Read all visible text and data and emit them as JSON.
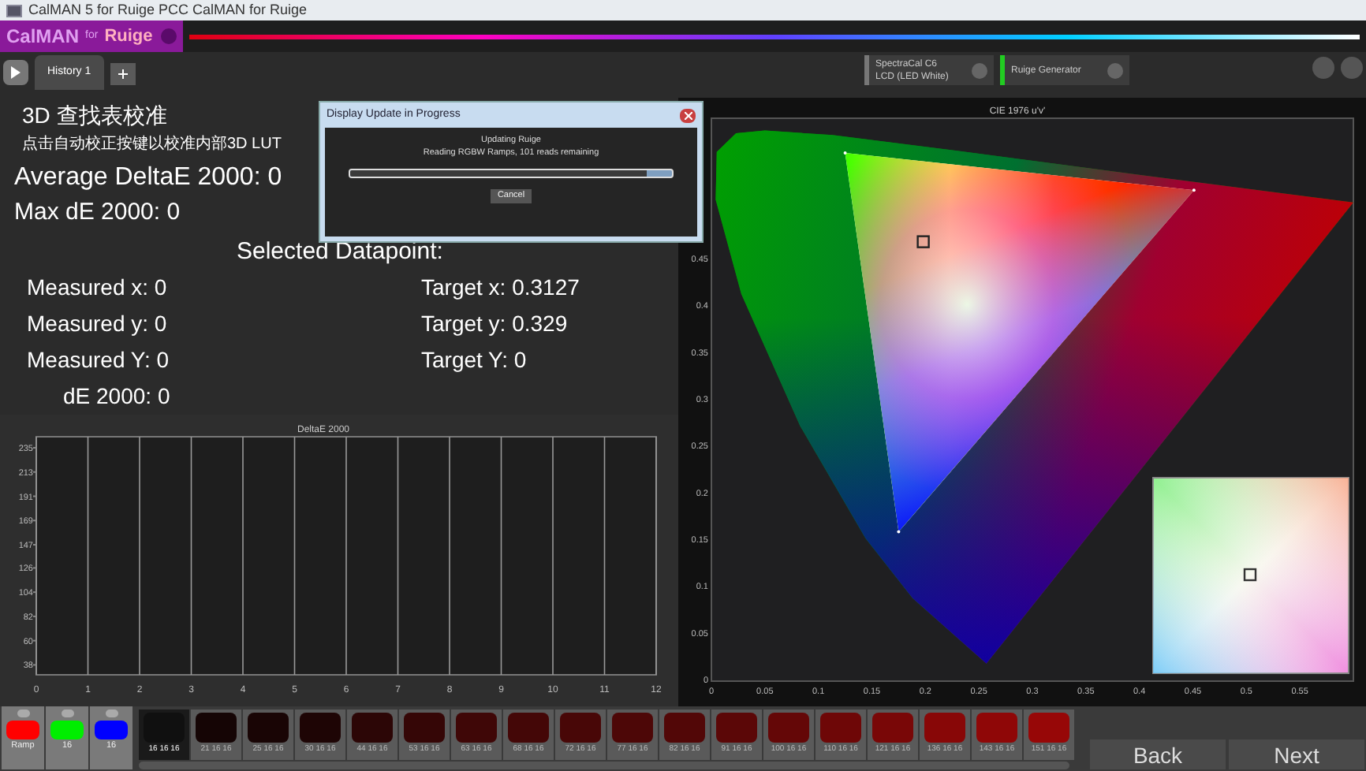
{
  "window": {
    "title": "CalMAN 5 for Ruige PCC CalMAN for Ruige"
  },
  "logo": {
    "parts": [
      "CalMAN",
      "for",
      "Ruige"
    ]
  },
  "tabs": [
    {
      "label": "History 1",
      "selected": true
    }
  ],
  "devices": [
    {
      "line1": "SpectraCal C6",
      "line2": "LCD (LED White)",
      "color": "#777777"
    },
    {
      "line1": "Ruige Generator",
      "color": "#22cc22"
    }
  ],
  "left": {
    "title": "3D 查找表校准",
    "subtitle": "点击自动校正按键以校准内部3D LUT",
    "average": "Average DeltaE 2000: 0",
    "max": "Max dE 2000: 0",
    "selected_title": "Selected Datapoint:",
    "measured": [
      "Measured x: 0",
      "Measured y: 0",
      "Measured Y: 0",
      "dE 2000: 0"
    ],
    "target": [
      "Target x: 0.3127",
      "Target y: 0.329",
      "Target Y: 0"
    ],
    "chart_data": {
      "type": "bar",
      "title": "DeltaE 2000",
      "grid": true,
      "xlim": [
        0,
        12
      ],
      "ylim": [
        29,
        245
      ],
      "xticks": [
        0,
        1,
        2,
        3,
        4,
        5,
        6,
        7,
        8,
        9,
        10,
        11,
        12
      ],
      "yticks": [
        38,
        60,
        82,
        104,
        126,
        147,
        169,
        191,
        213,
        235
      ]
    }
  },
  "cie": {
    "chart_data": {
      "type": "scatter",
      "title": "CIE 1976 u'v'",
      "xlim": [
        0,
        0.6
      ],
      "ylim": [
        0,
        0.6
      ],
      "xticks": [
        0,
        0.05,
        0.1,
        0.15,
        0.2,
        0.25,
        0.3,
        0.35,
        0.4,
        0.45,
        0.5,
        0.55
      ],
      "yticks": [
        0,
        0.05,
        0.1,
        0.15,
        0.2,
        0.25,
        0.3,
        0.35,
        0.4,
        0.45
      ],
      "x": [
        0.257,
        0.188,
        0.144,
        0.083,
        0.028,
        0.004,
        0.005,
        0.023,
        0.05,
        0.113,
        0.231,
        0.404,
        0.6,
        0.125,
        0.175,
        0.198,
        0.451
      ],
      "series": [
        {
          "type": "area",
          "color": "#008000",
          "values": [
            0.017,
            0.087,
            0.151,
            0.271,
            0.412,
            0.513,
            0.564,
            0.584,
            0.587,
            0.582,
            0.565,
            0.539,
            0.51,
            null,
            null,
            null,
            null
          ]
        },
        {
          "type": "area",
          "color": "#ffffff",
          "values": [
            null,
            null,
            null,
            null,
            null,
            null,
            null,
            null,
            null,
            null,
            null,
            null,
            null,
            0.563,
            0.158,
            null,
            0.523
          ]
        },
        {
          "type": "scatter",
          "color": "#222222",
          "values": [
            null,
            null,
            null,
            null,
            null,
            null,
            null,
            null,
            null,
            null,
            null,
            null,
            null,
            null,
            null,
            0.468,
            null
          ]
        }
      ]
    }
  },
  "dialog": {
    "title": "Display Update in Progress",
    "heading": "Updating Ruige",
    "message": "Reading RGBW Ramps, 101 reads remaining",
    "progress": {
      "level": 0.92
    },
    "button": "Cancel"
  },
  "patterns": [
    {
      "label": "Ramp",
      "color": "#ff0000"
    },
    {
      "label": "16",
      "color": "#00ee00"
    },
    {
      "label": "16",
      "color": "#0000ff"
    }
  ],
  "swatches": [
    {
      "label": "16 16 16",
      "color": "#101010",
      "selected": true
    },
    {
      "label": "21 16 16",
      "color": "#150505",
      "selected": false
    },
    {
      "label": "25 16 16",
      "color": "#190505",
      "selected": false
    },
    {
      "label": "30 16 16",
      "color": "#1e0505",
      "selected": false
    },
    {
      "label": "44 16 16",
      "color": "#2c0606",
      "selected": false
    },
    {
      "label": "53 16 16",
      "color": "#350606",
      "selected": false
    },
    {
      "label": "63 16 16",
      "color": "#3f0707",
      "selected": false
    },
    {
      "label": "68 16 16",
      "color": "#440707",
      "selected": false
    },
    {
      "label": "72 16 16",
      "color": "#480707",
      "selected": false
    },
    {
      "label": "77 16 16",
      "color": "#4d0707",
      "selected": false
    },
    {
      "label": "82 16 16",
      "color": "#520707",
      "selected": false
    },
    {
      "label": "91 16 16",
      "color": "#5b0707",
      "selected": false
    },
    {
      "label": "100 16 16",
      "color": "#640707",
      "selected": false
    },
    {
      "label": "110 16 16",
      "color": "#6e0707",
      "selected": false
    },
    {
      "label": "121 16 16",
      "color": "#790707",
      "selected": false
    },
    {
      "label": "136 16 16",
      "color": "#880707",
      "selected": false
    },
    {
      "label": "143 16 16",
      "color": "#8f0707",
      "selected": false
    },
    {
      "label": "151 16 16",
      "color": "#970707",
      "selected": false
    }
  ],
  "nav": [
    "Back",
    "Next"
  ]
}
